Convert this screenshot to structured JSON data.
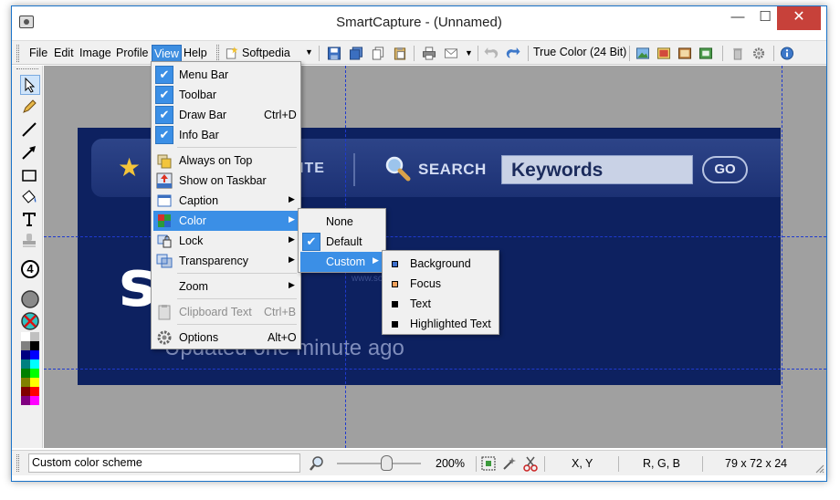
{
  "window": {
    "title": "SmartCapture - (Unnamed)",
    "minimize": "—",
    "maximize": "☐",
    "close": "✕"
  },
  "menubar": {
    "items": [
      "File",
      "Edit",
      "Image",
      "Profile",
      "View",
      "Help"
    ],
    "active": "View"
  },
  "toolbar": {
    "profile": "Softpedia",
    "profile_dropdown": "▼",
    "mail_dropdown": "▼",
    "color_depth": "True Color (24 Bit)"
  },
  "view_menu": {
    "items": [
      {
        "label": "Menu Bar",
        "checked": true
      },
      {
        "label": "Toolbar",
        "checked": true
      },
      {
        "label": "Draw Bar",
        "checked": true,
        "shortcut": "Ctrl+D"
      },
      {
        "label": "Info Bar",
        "checked": true
      },
      {
        "label": "Always on Top",
        "icon": "pin-icon"
      },
      {
        "label": "Show on Taskbar",
        "icon": "taskbar-icon"
      },
      {
        "label": "Caption",
        "icon": "caption-icon",
        "submenu": true
      },
      {
        "label": "Color",
        "icon": "color-icon",
        "submenu": true,
        "highlighted": true
      },
      {
        "label": "Lock",
        "icon": "lock-icon",
        "submenu": true
      },
      {
        "label": "Transparency",
        "icon": "transparency-icon",
        "submenu": true
      },
      {
        "label": "Zoom",
        "submenu": true
      },
      {
        "label": "Clipboard Text",
        "shortcut": "Ctrl+B",
        "disabled": true,
        "icon": "clipboard-icon"
      },
      {
        "label": "Options",
        "shortcut": "Alt+O",
        "icon": "options-gear-icon"
      }
    ]
  },
  "color_menu": {
    "items": [
      {
        "label": "None"
      },
      {
        "label": "Default",
        "checked": true
      },
      {
        "label": "Custom",
        "submenu": true,
        "highlighted": true
      }
    ]
  },
  "custom_menu": {
    "items": [
      {
        "label": "Background",
        "color": "#3d6fcc"
      },
      {
        "label": "Focus",
        "color": "#f2a15a"
      },
      {
        "label": "Text",
        "color": "#000000"
      },
      {
        "label": "Highlighted Text",
        "color": "#000000"
      }
    ]
  },
  "capture": {
    "nav_text": "ITE",
    "search_label": "SEARCH",
    "keywords": "Keywords",
    "go": "GO",
    "logo": "softpedia",
    "logo_visible": "s  ti",
    "updated": "Updated one minute ago",
    "watermark": "www.softpedia.com"
  },
  "draw_tools": [
    "select-arrow-icon",
    "pencil-icon",
    "line-icon",
    "arrow-line-icon",
    "rectangle-icon",
    "fill-bucket-icon",
    "text-tool-icon",
    "stamp-icon",
    "number-stamp-icon",
    "color-circle-icon",
    "no-color-icon"
  ],
  "draw_number": "4",
  "palette": [
    "#ffffff",
    "#c0c0c0",
    "#808080",
    "#000000",
    "#000080",
    "#0000ff",
    "#008080",
    "#00ffff",
    "#008000",
    "#00ff00",
    "#808000",
    "#ffff00",
    "#800000",
    "#ff0000",
    "#800080",
    "#ff00ff"
  ],
  "statusbar": {
    "message": "Custom color scheme",
    "zoom": "200%",
    "coords": "X, Y",
    "rgb": "R, G, B",
    "size": "79 x 72 x 24"
  },
  "colors": {
    "accent": "#3b8fe6",
    "close": "#c7413a",
    "capture_bg": "#0d2160",
    "guide": "#1f3ad0"
  }
}
